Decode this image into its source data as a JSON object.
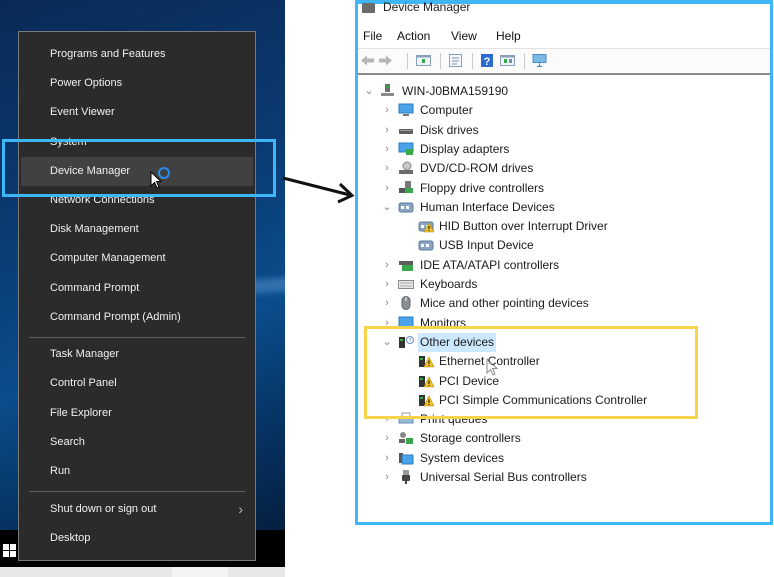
{
  "winx_menu": {
    "items": [
      {
        "label": "Programs and Features"
      },
      {
        "label": "Power Options"
      },
      {
        "label": "Event Viewer"
      },
      {
        "label": "System"
      },
      {
        "label": "Device Manager",
        "state": "hover"
      },
      {
        "label": "Network Connections"
      },
      {
        "label": "Disk Management"
      },
      {
        "label": "Computer Management"
      },
      {
        "label": "Command Prompt"
      },
      {
        "label": "Command Prompt (Admin)"
      },
      {
        "label": "Task Manager"
      },
      {
        "label": "Control Panel"
      },
      {
        "label": "File Explorer"
      },
      {
        "label": "Search"
      },
      {
        "label": "Run"
      },
      {
        "label": "Shut down or sign out",
        "submenu_icon": "chevron-right-icon"
      },
      {
        "label": "Desktop"
      }
    ]
  },
  "annotations": {
    "highlight_color": "#3fb6f7",
    "focus_color": "#f7d44a",
    "arrow_icon": "arrow-right-icon"
  },
  "device_manager": {
    "title": "Device Manager",
    "menu": [
      "File",
      "Action",
      "View",
      "Help"
    ],
    "toolbar": [
      "back-icon",
      "forward-icon",
      "show-hide-console-tree-icon",
      "properties-icon",
      "help-icon",
      "action-pane-icon",
      "scan-hardware-icon"
    ],
    "root": "WIN-J0BMA159190",
    "tree": [
      {
        "label": "Computer",
        "icon": "computer-icon",
        "expanded": false
      },
      {
        "label": "Disk drives",
        "icon": "disk-drive-icon",
        "expanded": false
      },
      {
        "label": "Display adapters",
        "icon": "display-adapter-icon",
        "expanded": false
      },
      {
        "label": "DVD/CD-ROM drives",
        "icon": "dvd-drive-icon",
        "expanded": false
      },
      {
        "label": "Floppy drive controllers",
        "icon": "floppy-controller-icon",
        "expanded": false
      },
      {
        "label": "Human Interface Devices",
        "icon": "hid-icon",
        "expanded": true,
        "children": [
          {
            "label": "HID Button over Interrupt Driver",
            "warning": true
          },
          {
            "label": "USB Input Device",
            "warning": false
          }
        ]
      },
      {
        "label": "IDE ATA/ATAPI controllers",
        "icon": "ide-controller-icon",
        "expanded": false
      },
      {
        "label": "Keyboards",
        "icon": "keyboard-icon",
        "expanded": false
      },
      {
        "label": "Mice and other pointing devices",
        "icon": "mouse-icon",
        "expanded": false
      },
      {
        "label": "Monitors",
        "icon": "monitor-icon",
        "expanded": false
      },
      {
        "label": "Other devices",
        "icon": "unknown-device-icon",
        "expanded": true,
        "selected": true,
        "children": [
          {
            "label": "Ethernet Controller",
            "warning": true
          },
          {
            "label": "PCI Device",
            "warning": true
          },
          {
            "label": "PCI Simple Communications Controller",
            "warning": true
          }
        ]
      },
      {
        "label": "Print queues",
        "icon": "printer-icon",
        "expanded": false
      },
      {
        "label": "Storage controllers",
        "icon": "storage-controller-icon",
        "expanded": false
      },
      {
        "label": "System devices",
        "icon": "system-devices-icon",
        "expanded": false
      },
      {
        "label": "Universal Serial Bus controllers",
        "icon": "usb-icon",
        "expanded": false
      }
    ]
  }
}
